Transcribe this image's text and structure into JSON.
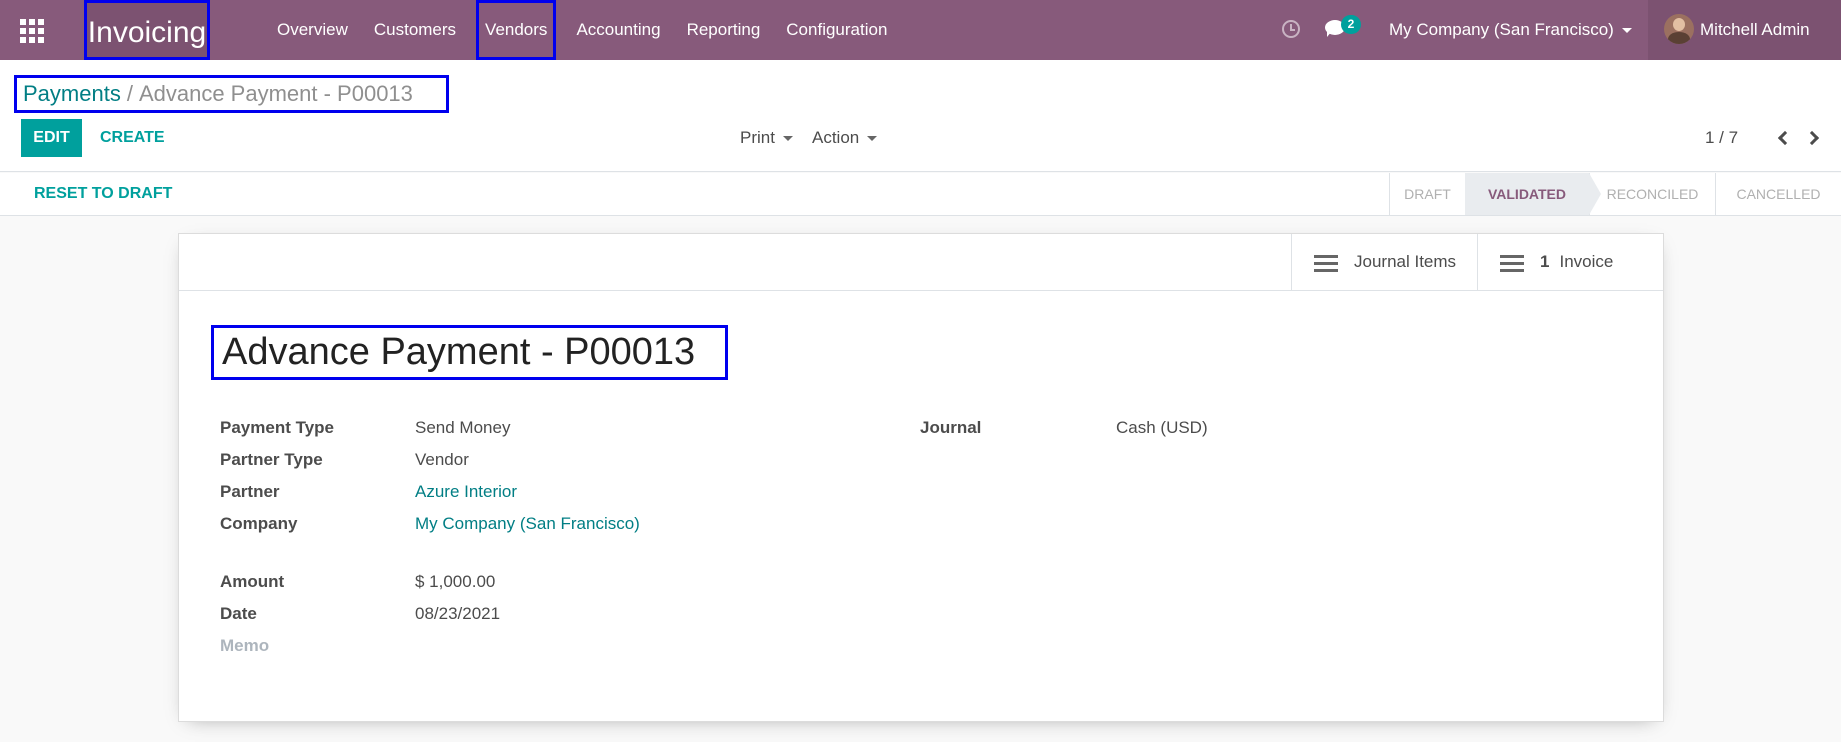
{
  "navbar": {
    "brand": "Invoicing",
    "menu": [
      "Overview",
      "Customers",
      "Vendors",
      "Accounting",
      "Reporting",
      "Configuration"
    ],
    "messages_count": "2",
    "company": "My Company (San Francisco)",
    "user": "Mitchell Admin",
    "brand_color": "#875a7b"
  },
  "control_panel": {
    "breadcrumb": {
      "parent": "Payments",
      "separator": "/",
      "current": "Advance Payment - P00013"
    },
    "edit_label": "EDIT",
    "create_label": "CREATE",
    "print_label": "Print",
    "action_label": "Action",
    "pager": "1 / 7"
  },
  "statusbar": {
    "reset_label": "RESET TO DRAFT",
    "stages": [
      "DRAFT",
      "VALIDATED",
      "RECONCILED",
      "CANCELLED"
    ],
    "active_stage": "VALIDATED"
  },
  "sheet": {
    "smart_buttons": {
      "journal_items_label": "Journal Items",
      "invoice_count": "1",
      "invoice_label": "Invoice"
    },
    "title": "Advance Payment - P00013",
    "fields": {
      "payment_type": {
        "label": "Payment Type",
        "value": "Send Money"
      },
      "partner_type": {
        "label": "Partner Type",
        "value": "Vendor"
      },
      "partner": {
        "label": "Partner",
        "value": "Azure Interior"
      },
      "company": {
        "label": "Company",
        "value": "My Company (San Francisco)"
      },
      "amount": {
        "label": "Amount",
        "value": "$ 1,000.00"
      },
      "date": {
        "label": "Date",
        "value": "08/23/2021"
      },
      "memo": {
        "label": "Memo",
        "value": ""
      },
      "journal": {
        "label": "Journal",
        "value": "Cash (USD)"
      }
    }
  }
}
